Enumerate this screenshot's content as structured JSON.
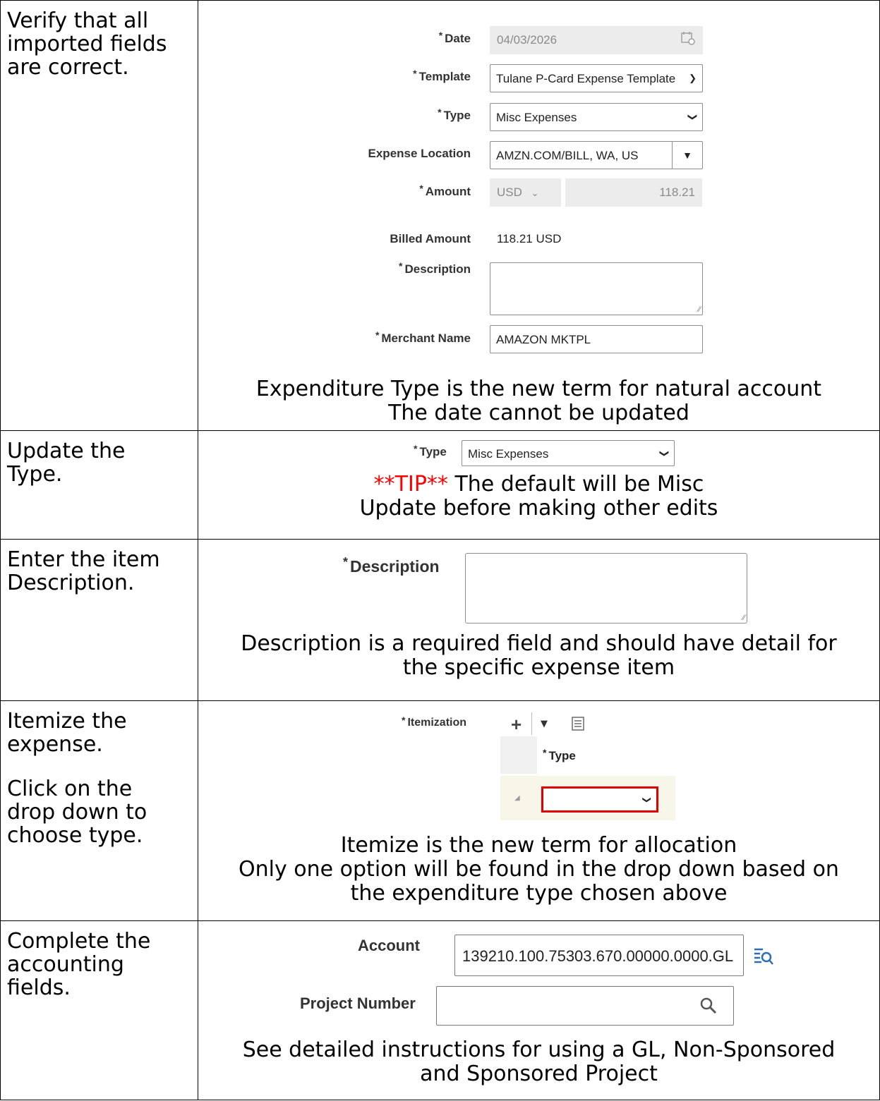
{
  "rows": [
    {
      "instruction": [
        "Verify that all",
        "imported fields",
        "are correct."
      ],
      "form": {
        "date_label": "Date",
        "date_value": "04/03/2026",
        "template_label": "Template",
        "template_value": "Tulane P-Card Expense Template",
        "type_label": "Type",
        "type_value": "Misc Expenses",
        "location_label": "Expense Location",
        "location_value": "AMZN.COM/BILL, WA, US",
        "amount_label": "Amount",
        "amount_currency": "USD",
        "amount_value": "118.21",
        "billed_label": "Billed Amount",
        "billed_value": "118.21 USD",
        "description_label": "Description",
        "merchant_label": "Merchant Name",
        "merchant_value": "AMAZON MKTPL"
      },
      "caption": [
        "Expenditure Type is the new term for natural account",
        "The date cannot be updated"
      ]
    },
    {
      "instruction": [
        "Update the",
        "Type."
      ],
      "type_label": "Type",
      "type_value": "Misc Expenses",
      "tip": "**TIP**",
      "caption": [
        " The default will be Misc",
        "Update before making other edits"
      ]
    },
    {
      "instruction": [
        "Enter the item",
        "Description."
      ],
      "description_label": "Description",
      "caption": [
        "Description is a required field and should have detail for",
        "the specific expense item"
      ]
    },
    {
      "instruction": [
        "Itemize the",
        "expense.",
        "Click on the",
        "drop down to",
        "choose type."
      ],
      "itemization_label": "Itemization",
      "type_header": "Type",
      "caption": [
        "Itemize is the new term for allocation",
        "Only one option will be found in the drop down based on",
        "the expenditure type chosen above"
      ]
    },
    {
      "instruction": [
        "Complete the",
        "accounting",
        "fields."
      ],
      "account_label": "Account",
      "account_value": "139210.100.75303.670.00000.0000.GL",
      "project_label": "Project Number",
      "caption": [
        "See detailed instructions for using a GL, Non-Sponsored",
        "and Sponsored Project"
      ]
    }
  ],
  "colors": {
    "tip": "#ff0000",
    "highlight_border": "#e00000",
    "itemization_row_bg": "#f7f6e8"
  },
  "icons": [
    "calendar-icon",
    "chevron-down-icon",
    "dropdown-triangle-icon",
    "add-icon",
    "detach-icon",
    "search-list-icon",
    "magnifier-icon",
    "resize-grip-icon"
  ]
}
